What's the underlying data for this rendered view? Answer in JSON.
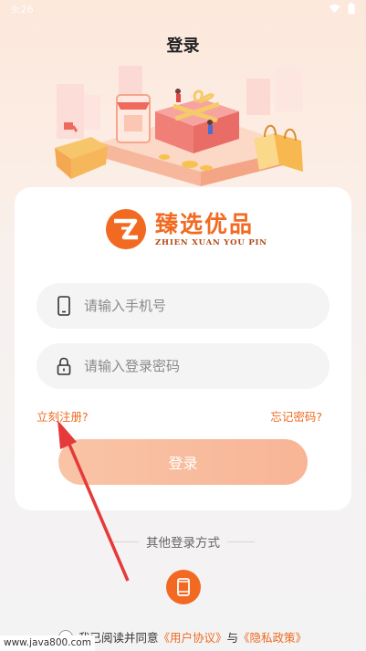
{
  "status_bar": {
    "time": "9:26"
  },
  "page_title": "登录",
  "brand": {
    "name": "臻选优品",
    "pinyin": "ZHIEN XUAN YOU PIN"
  },
  "form": {
    "phone_placeholder": "请输入手机号",
    "password_placeholder": "请输入登录密码",
    "register_label": "立刻注册?",
    "forgot_label": "忘记密码?",
    "login_label": "登录"
  },
  "other_login": {
    "label": "其他登录方式"
  },
  "agreement": {
    "prefix": "我已阅读并同意",
    "user_agreement": "《用户协议》",
    "conjunction": "与",
    "privacy_policy": "《隐私政策》"
  },
  "watermark": "www.java800.com",
  "colors": {
    "accent": "#f26a22",
    "link": "#ef6a20",
    "button": "#f8b596"
  }
}
